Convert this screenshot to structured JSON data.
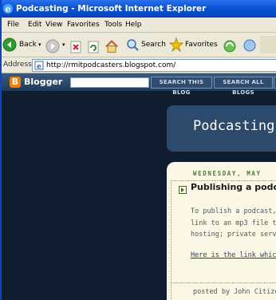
{
  "window": {
    "title": "Podcasting - Microsoft Internet Explorer"
  },
  "menu": [
    "File",
    "Edit",
    "View",
    "Favorites",
    "Tools",
    "Help"
  ],
  "toolbar": {
    "back_label": "Back",
    "search_label": "Search",
    "favorites_label": "Favorites"
  },
  "address": {
    "label": "Address",
    "url": "http://rmitpodcasters.blogspot.com/"
  },
  "blogger_bar": {
    "logo_letter": "B",
    "brand": "Blogger",
    "search_this_blog": "SEARCH THIS BLOG",
    "search_all_blogs": "SEARCH ALL BLOGS"
  },
  "blog": {
    "header_title": "Podcasting"
  },
  "post": {
    "date": "WEDNESDAY, MAY",
    "title": "Publishing a podc",
    "body_lines": [
      "To publish a podcast, fi",
      "link to an mp3 file that",
      "hosting; private server)"
    ],
    "link_text": "Here is the link which I",
    "footer": "posted by John Citizen"
  },
  "colors": {
    "titlebar_blue": "#0a56d8",
    "page_background": "#0f1d2e",
    "header_box": "#2b4a6c",
    "post_background": "#fbf9e6",
    "date_green": "#4a7a34",
    "blogger_orange": "#f57d00"
  }
}
